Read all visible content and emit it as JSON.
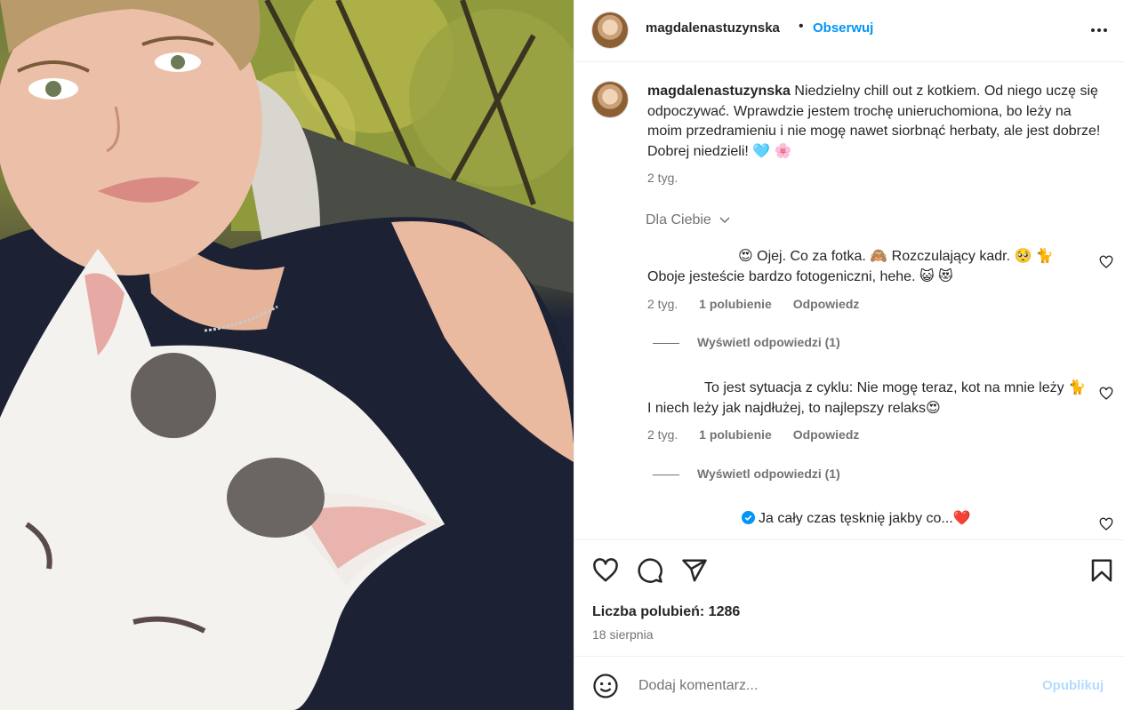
{
  "post": {
    "username": "magdalenastuzynska",
    "follow_label": "Obserwuj",
    "separator": "•",
    "caption_text": "Niedzielny chill out z kotkiem. Od niego uczę się odpoczywać. Wprawdzie jestem trochę unieruchomiona, bo leży na moim przedramieniu i nie mogę nawet siorbnąć herbaty, ale jest dobrze! Dobrej niedzieli! 🩵 🌸",
    "caption_time": "2 tyg.",
    "sort_label": "Dla Ciebie"
  },
  "comments": [
    {
      "text": "😍 Ojej. Co za fotka. 🙈 Rozczulający kadr. 🥺 🐈 Oboje jesteście bardzo fotogeniczni, hehe. 😺 😻",
      "time": "2 tyg.",
      "likes": "1 polubienie",
      "reply": "Odpowiedz",
      "view_replies": "Wyświetl odpowiedzi (1)"
    },
    {
      "text": "To jest sytuacja z cyklu: Nie mogę teraz, kot na mnie leży 🐈 I niech leży jak najdłużej, to najlepszy relaks😍",
      "time": "2 tyg.",
      "likes": "1 polubienie",
      "reply": "Odpowiedz",
      "view_replies": "Wyświetl odpowiedzi (1)"
    },
    {
      "text": "Ja cały czas tęsknię jakby co...❤️"
    }
  ],
  "footer": {
    "likes_label": "Liczba polubień: 1286",
    "date": "18 sierpnia",
    "comment_placeholder": "Dodaj komentarz...",
    "publish_label": "Opublikuj"
  },
  "icons": {
    "more": "more-horizontal-icon",
    "like": "heart-icon",
    "comment": "comment-icon",
    "share": "send-icon",
    "save": "bookmark-icon",
    "emoji": "emoji-icon",
    "verified": "verified-badge-icon"
  },
  "colors": {
    "link": "#0095f6",
    "muted": "#737373",
    "publish_disabled": "#b3dbff",
    "verified": "#0095f6"
  }
}
